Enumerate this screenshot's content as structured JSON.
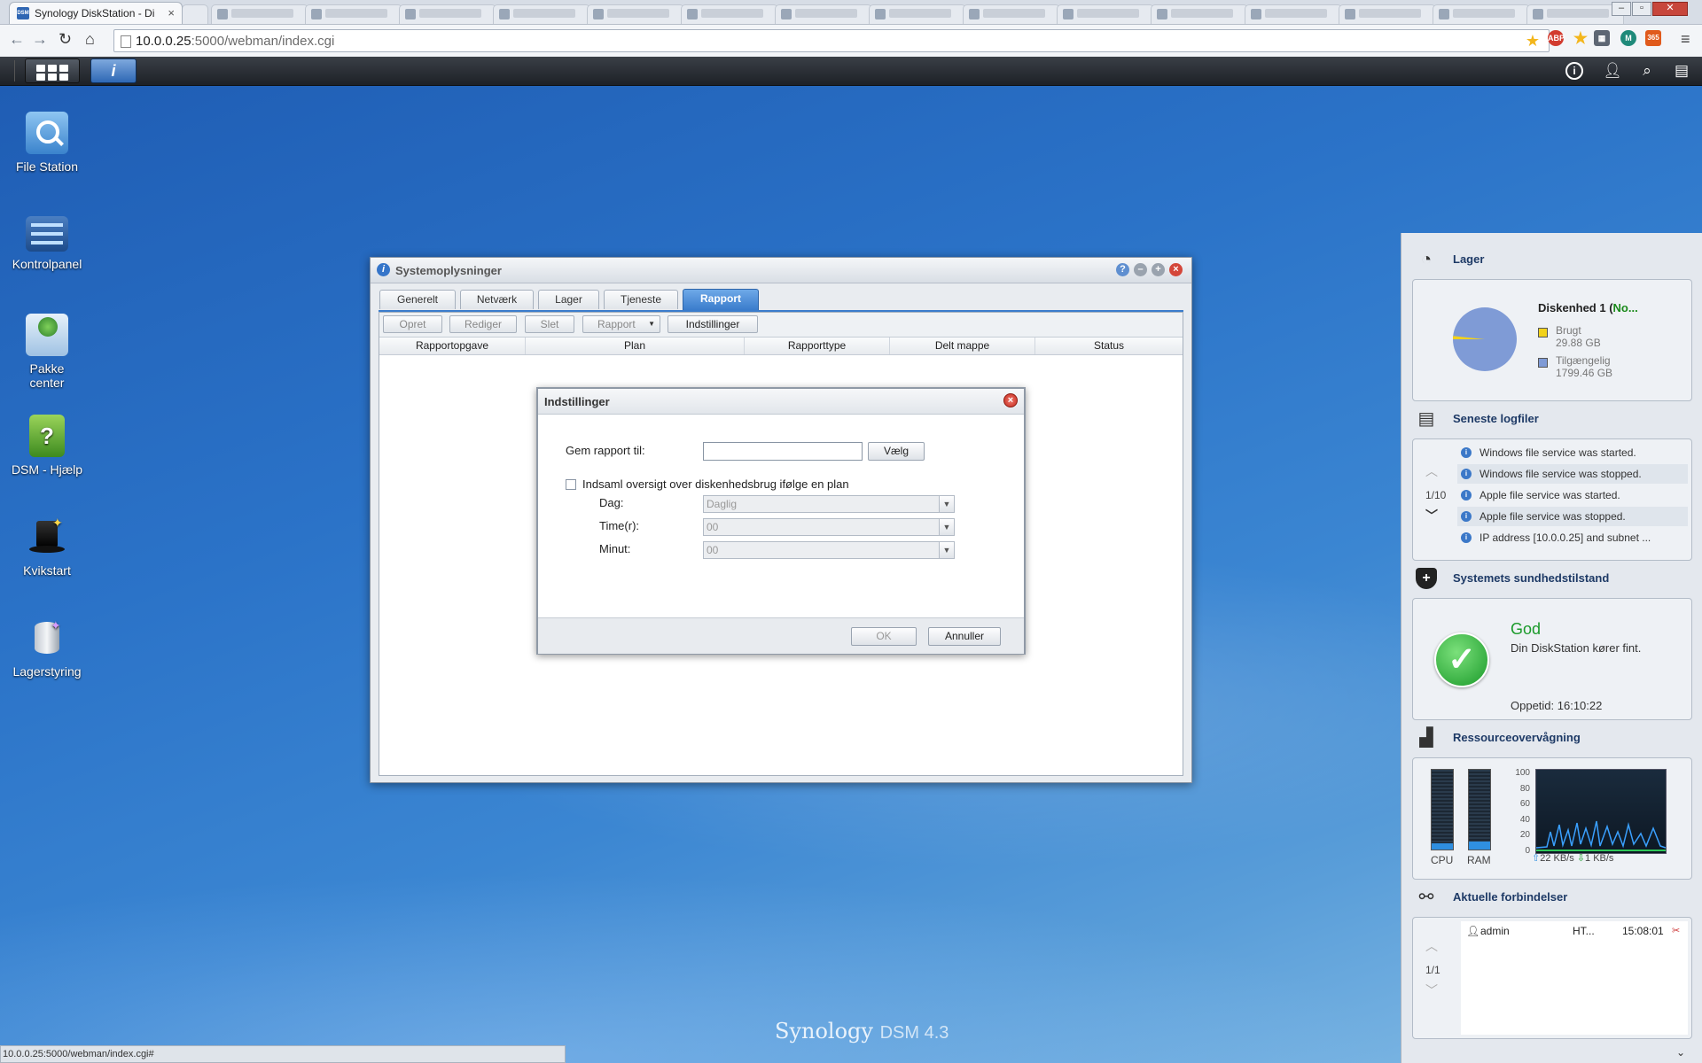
{
  "browser": {
    "active_tab_title": "Synology DiskStation - Di",
    "favicon_text": "DSM",
    "close_glyph": "×",
    "url_host": "10.0.0.25",
    "url_rest": ":5000/webman/index.cgi",
    "status_url": "10.0.0.25:5000/webman/index.cgi#",
    "extensions": [
      "abp-icon",
      "star-icon",
      "reader-icon",
      "m-icon",
      "rss-icon"
    ],
    "ext_abp_text": "ABP",
    "ext_m_text": "M",
    "ext_rss_text": "365"
  },
  "dsm_bar": {
    "info_glyph": "i"
  },
  "desktop_icons": [
    {
      "label": "File Station"
    },
    {
      "label": "Kontrolpanel"
    },
    {
      "label": "Pakke center"
    },
    {
      "label": "DSM - Hjælp"
    },
    {
      "label": "Kvikstart"
    },
    {
      "label": "Lagerstyring"
    }
  ],
  "logo": {
    "brand": "Synology",
    "version": "DSM 4.3"
  },
  "window": {
    "title": "Systemoplysninger",
    "tabs": [
      "Generelt",
      "Netværk",
      "Lager",
      "Tjeneste",
      "Rapport"
    ],
    "active_tab": "Rapport",
    "toolbar": [
      "Opret",
      "Rediger",
      "Slet",
      "Rapport",
      "Indstillinger"
    ],
    "columns": [
      "Rapportopgave",
      "Plan",
      "Rapporttype",
      "Delt mappe",
      "Status"
    ]
  },
  "dialog": {
    "title": "Indstillinger",
    "save_label": "Gem rapport til:",
    "save_value": "",
    "choose_button": "Vælg",
    "schedule_checkbox": "Indsaml oversigt over diskenhedsbrug ifølge en plan",
    "schedule_checked": false,
    "day_label": "Dag:",
    "day_value": "Daglig",
    "hour_label": "Time(r):",
    "hour_value": "00",
    "minute_label": "Minut:",
    "minute_value": "00",
    "ok_button": "OK",
    "cancel_button": "Annuller"
  },
  "widgets": {
    "storage": {
      "title": "Lager",
      "volume": "Diskenhed 1 (",
      "volume_status": "No...",
      "used_label": "Brugt",
      "used_value": "29.88 GB",
      "used_gb": 29.88,
      "free_label": "Tilgængelig",
      "free_value": "1799.46 GB",
      "free_gb": 1799.46,
      "used_color": "#f2d21b",
      "free_color": "#7f9bd6"
    },
    "logs": {
      "title": "Seneste logfiler",
      "page": "1/10",
      "items": [
        "Windows file service was started.",
        "Windows file service was stopped.",
        "Apple file service was started.",
        "Apple file service was stopped.",
        "IP address [10.0.0.25] and subnet ..."
      ]
    },
    "health": {
      "title": "Systemets sundhedstilstand",
      "status": "God",
      "message": "Din DiskStation kører fint.",
      "uptime": "Oppetid: 16:10:22"
    },
    "resource": {
      "title": "Ressourceovervågning",
      "cpu_label": "CPU",
      "ram_label": "RAM",
      "cpu_fraction": 0.08,
      "ram_fraction": 0.1,
      "y_ticks": [
        "100",
        "80",
        "60",
        "40",
        "20",
        "0"
      ],
      "upload": "22 KB/s",
      "download": "1 KB/s"
    },
    "connections": {
      "title": "Aktuelle forbindelser",
      "page": "1/1",
      "rows": [
        {
          "user": "admin",
          "type": "HT...",
          "time": "15:08:01"
        }
      ]
    }
  }
}
